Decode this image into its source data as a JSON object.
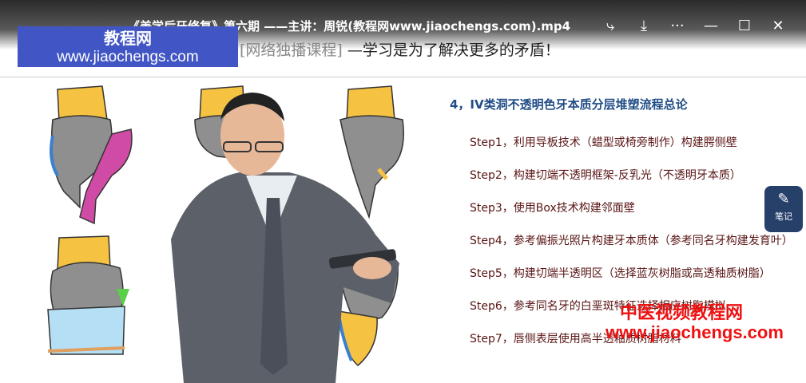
{
  "player": {
    "title": "《美学后牙修复》第六期 ——主讲：周锐(教程网www.jiaochengs.com).mp4",
    "controls": [
      {
        "name": "share-icon",
        "glyph": "⤷"
      },
      {
        "name": "download-icon",
        "glyph": "⤓"
      },
      {
        "name": "more-icon",
        "glyph": "···"
      },
      {
        "name": "minimize-icon",
        "glyph": "—"
      },
      {
        "name": "maximize-icon",
        "glyph": "☐"
      },
      {
        "name": "close-icon",
        "glyph": "✕"
      }
    ],
    "note_button": {
      "icon": "note-edit-icon",
      "label": "笔记"
    }
  },
  "logo": {
    "line1": "教程网",
    "line2": "www.jiaochengs.com"
  },
  "slide": {
    "slogan_bracket": "[网络独播课程]",
    "slogan_text": "—学习是为了解决更多的矛盾！",
    "heading": "4，IV类洞不透明色牙本质分层堆塑流程总论",
    "steps": [
      "Step1，利用导板技术（蜡型或椅旁制作）构建腭侧壁",
      "Step2，构建切端不透明框架-反乳光（不透明牙本质）",
      "Step3，使用Box技术构建邻面壁",
      "Step4，参考偏振光照片构建牙本质体（参考同名牙构建发育叶）",
      "Step5，构建切端半透明区（选择蓝灰树脂或高透釉质树脂）",
      "Step6，参考同名牙的白垩斑特征选择相应树脂模拟",
      "Step7，唇侧表层使用高半透釉质树脂材料"
    ]
  },
  "watermark": {
    "line1": "中医视频教程网",
    "line2": "www.jiaochengs.com"
  },
  "colors": {
    "accent": "#214d87",
    "logo_bg": "#4156c4",
    "watermark": "#ee1111",
    "enamel": "#f5c242",
    "dentin": "#909090",
    "palatal": "#d04ba5",
    "translucent": "#b5dff5"
  }
}
